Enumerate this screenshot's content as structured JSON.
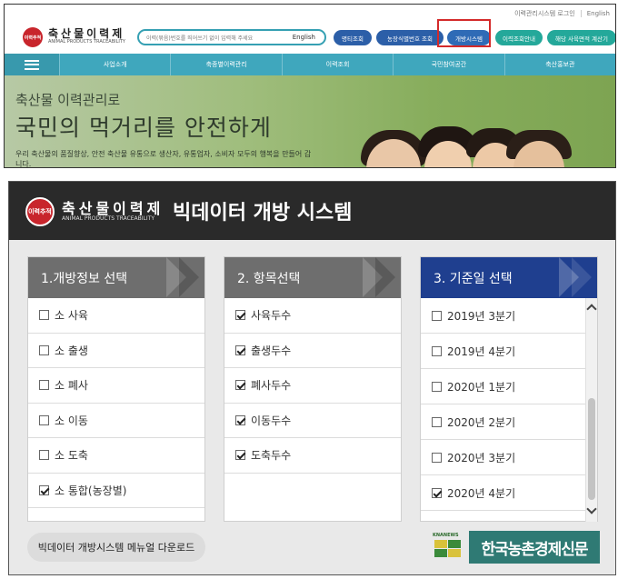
{
  "top_site": {
    "utility": {
      "login": "이력관리시스템 로그인",
      "english": "English"
    },
    "logo": {
      "badge": "이력추적",
      "title": "축산물이력제",
      "subtitle": "ANIMAL PRODUCTS TRACEABILITY"
    },
    "search": {
      "placeholder": "이력(묶음)번호를 띄어쓰기 없이 입력해 주세요",
      "language": "English"
    },
    "buttons": [
      "명티조회",
      "농장식별번호 조회",
      "개방시스템",
      "이력조회안내",
      "해당 사육면적 계산기"
    ],
    "highlighted_button": "개방시스템",
    "nav": [
      "사업소개",
      "축종별이력관리",
      "이력조회",
      "국민참여공간",
      "축산홍보관"
    ],
    "hero": {
      "line1": "축산물 이력관리로",
      "line2": "국민의 먹거리를 안전하게",
      "desc": "우리 축산물의 품질향상, 안전 축산물 유통으로 생산자, 유통업자, 소비자 모두의 행복을 만들어 갑니다."
    }
  },
  "bigdata": {
    "logo": {
      "badge": "이력추적",
      "title": "축산물이력제",
      "subtitle": "ANIMAL PRODUCTS TRACEABILITY"
    },
    "title": "빅데이터 개방 시스템",
    "panel1": {
      "header": "1.개방정보 선택",
      "options": [
        {
          "label": "소 사육",
          "checked": false
        },
        {
          "label": "소 출생",
          "checked": false
        },
        {
          "label": "소 폐사",
          "checked": false
        },
        {
          "label": "소 이동",
          "checked": false
        },
        {
          "label": "소 도축",
          "checked": false
        },
        {
          "label": "소 통합(농장별)",
          "checked": true
        }
      ]
    },
    "panel2": {
      "header": "2. 항목선택",
      "options": [
        {
          "label": "사육두수",
          "checked": true
        },
        {
          "label": "출생두수",
          "checked": true
        },
        {
          "label": "폐사두수",
          "checked": true
        },
        {
          "label": "이동두수",
          "checked": true
        },
        {
          "label": "도축두수",
          "checked": true
        }
      ]
    },
    "panel3": {
      "header": "3. 기준일 선택",
      "options": [
        {
          "label": "2019년 3분기",
          "checked": false
        },
        {
          "label": "2019년 4분기",
          "checked": false
        },
        {
          "label": "2020년 1분기",
          "checked": false
        },
        {
          "label": "2020년 2분기",
          "checked": false
        },
        {
          "label": "2020년 3분기",
          "checked": false
        },
        {
          "label": "2020년 4분기",
          "checked": true
        }
      ]
    },
    "manual_button": "빅데이터 개방시스템 메뉴얼 다운로드",
    "watermark": {
      "sub": "KNANEWS",
      "name": "한국농촌경제신문"
    }
  }
}
